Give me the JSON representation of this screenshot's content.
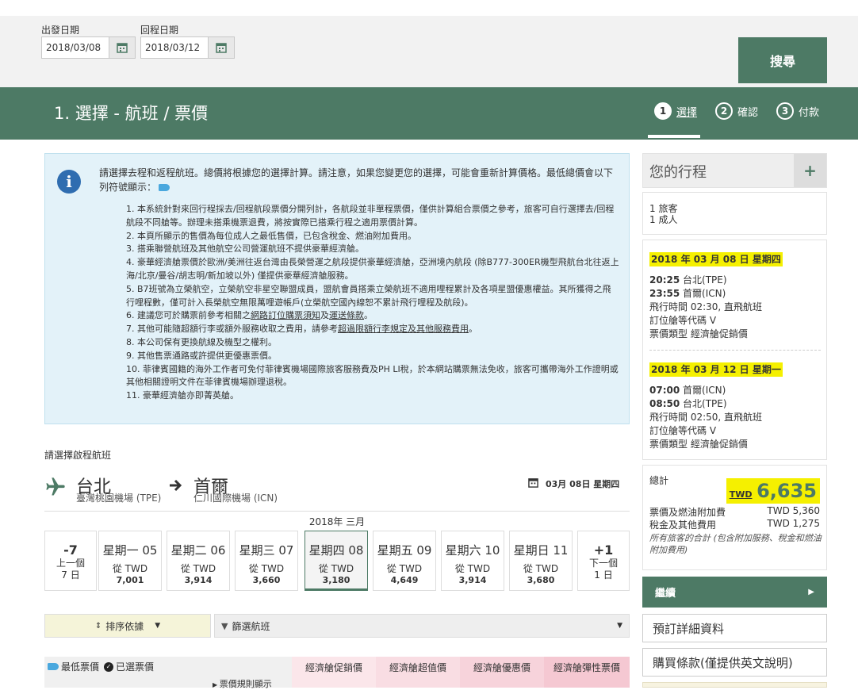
{
  "search": {
    "depart_label": "出發日期",
    "depart_value": "2018/03/08",
    "return_label": "回程日期",
    "return_value": "2018/03/12",
    "search_button": "搜尋"
  },
  "header": {
    "title": "1. 選擇 - 航班 / 票價",
    "steps": [
      {
        "num": "1",
        "label": "選擇"
      },
      {
        "num": "2",
        "label": "確認"
      },
      {
        "num": "3",
        "label": "付款"
      }
    ]
  },
  "info": {
    "intro": "請選擇去程和返程航班。總價將根據您的選擇計算。請注意，如果您變更您的選擇，可能會重新計算價格。最低總價會以下列符號顯示：",
    "notes": [
      "1. 本系統針對來回行程採去/回程航段票價分開列計，各航段並非單程票價，僅供計算組合票價之參考，旅客可自行選擇去/回程航段不同艙等。辦理未搭乘機票退費，將按實際已搭乘行程之適用票價計算。",
      "2. 本頁所顯示的售價為每位成人之最低售價，已包含稅金、燃油附加費用。",
      "3. 搭乘聯營航班及其他航空公司營運航班不提供豪華經濟艙。",
      "4. 豪華經濟艙票價於歐洲/美洲往返台灣由長榮營運之航段提供豪華經濟艙，亞洲境內航段 (除B777-300ER機型飛航台北往返上海/北京/曼谷/胡志明/新加坡以外) 僅提供豪華經濟艙服務。",
      "5. B7班號為立榮航空，立榮航空非星空聯盟成員，盟航會員搭乘立榮航班不適用哩程累計及各項星盟優惠權益。其所獲得之飛行哩程數，僅可計入長榮航空無限萬哩遊帳戶(立榮航空國內線恕不累計飛行哩程及航段)。",
      "6. 建議您可於購票前參考相關之",
      "7. 其他可能隨超額行李或額外服務收取之費用，請參考",
      "8. 本公司保有更換航線及機型之權利。",
      "9. 其他售票通路或許提供更優惠票價。",
      "10. 菲律賓國籍的海外工作者可免付菲律賓機場國際旅客服務費及PH LI稅，於本網站購票無法免收，旅客可攜帶海外工作證明或其他相關證明文件在菲律賓機場辦理退稅。",
      "11. 豪華經濟艙亦即菁英艙。"
    ],
    "note6_link1": "網路訂位購票須知",
    "note6_and": "及",
    "note6_link2": "運送條款",
    "note6_end": "。",
    "note7_link": "超過限額行李規定及其他服務費用",
    "note7_end": "。"
  },
  "outbound": {
    "section_label": "請選擇啟程航班",
    "from_city": "台北",
    "from_airport": "臺灣桃園機場 (TPE)",
    "to_city": "首爾",
    "to_airport": "仁川國際機場 (ICN)",
    "date_label": "03月 08日 星期四",
    "month_label": "2018年 三月",
    "prev": {
      "big": "-7",
      "l1": "上一個",
      "l2": "7 日"
    },
    "next": {
      "big": "+1",
      "l1": "下一個",
      "l2": "1 日"
    },
    "days": [
      {
        "day": "星期一 05",
        "from": "從 TWD",
        "price": "7,001"
      },
      {
        "day": "星期二 06",
        "from": "從 TWD",
        "price": "3,914"
      },
      {
        "day": "星期三 07",
        "from": "從 TWD",
        "price": "3,660"
      },
      {
        "day": "星期四 08",
        "from": "從 TWD",
        "price": "3,180"
      },
      {
        "day": "星期五 09",
        "from": "從 TWD",
        "price": "4,649"
      },
      {
        "day": "星期六 10",
        "from": "從 TWD",
        "price": "3,914"
      },
      {
        "day": "星期日 11",
        "from": "從 TWD",
        "price": "3,680"
      }
    ],
    "sort_label": "排序依據",
    "filter_label": "篩選航班",
    "legend_lowest": "最低票價",
    "legend_selected": "已選票價",
    "fare_rules": "票價規則顯示",
    "fare_types": [
      "經濟艙促銷價",
      "經濟艙超值價",
      "經濟艙優惠價",
      "經濟艙彈性票價"
    ]
  },
  "itinerary": {
    "title": "您的行程",
    "pax_count": "1 旅客",
    "pax_type": "1 成人",
    "seg1": {
      "date": "2018 年 03 月 08 日 星期四",
      "dep": "20:25",
      "dep_city": "台北(TPE)",
      "arr": "23:55",
      "arr_city": "首爾(ICN)",
      "duration": "飛行時間 02:30, 直飛航班",
      "class": "訂位艙等代碼 V",
      "fare": "票價類型 經濟艙促銷價"
    },
    "seg2": {
      "date": "2018 年 03 月 12 日 星期一",
      "dep": "07:00",
      "dep_city": "首爾(ICN)",
      "arr": "08:50",
      "arr_city": "台北(TPE)",
      "duration": "飛行時間 02:50, 直飛航班",
      "class": "訂位艙等代碼 V",
      "fare": "票價類型 經濟艙促銷價"
    },
    "total_label": "總計",
    "total_currency": "TWD",
    "total_amount": "6,635",
    "fare_label": "票價及燃油附加費",
    "fare_value": "TWD 5,360",
    "tax_label": "稅金及其他費用",
    "tax_value": "TWD 1,275",
    "note": "所有旅客的合計 (包含附加服務、稅金和燃油附加費用)",
    "continue": "繼續",
    "booking_details": "預訂詳細資料",
    "terms": "購買條款(僅提供英文說明)"
  }
}
